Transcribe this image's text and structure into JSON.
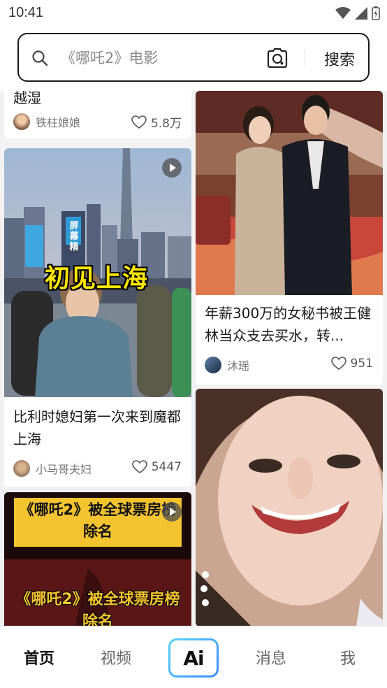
{
  "status": {
    "time": "10:41"
  },
  "search": {
    "placeholder": "《哪吒2》电影",
    "button_label": "搜索"
  },
  "feed": {
    "left": [
      {
        "title": "越湿",
        "author": "铁柱娘娘",
        "likes": "5.8万"
      },
      {
        "title": "比利时媳妇第一次来到魔都上海",
        "author": "小马哥夫妇",
        "likes": "5447",
        "overlay_text": "初见上海",
        "tower_text": "屏幕精"
      },
      {
        "banner_top": "《哪吒2》被全球票房榜除名",
        "banner_bottom": "《哪吒2》被全球票房榜除名"
      }
    ],
    "right": [
      {
        "title": "年薪300万的女秘书被王健林当众支去买水，转...",
        "author": "沐瑶",
        "likes": "951"
      },
      {}
    ]
  },
  "nav": {
    "home": "首页",
    "video": "视频",
    "ai": "Ai",
    "messages": "消息",
    "me": "我"
  },
  "colors": {
    "ai_gradient_start": "#57d2ff",
    "ai_gradient_end": "#3a8bff",
    "banner_yellow": "#f4c430"
  }
}
